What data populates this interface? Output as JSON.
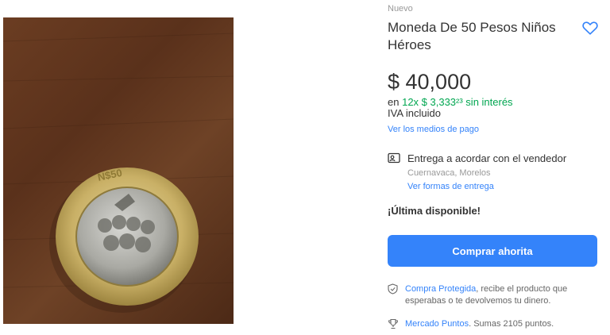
{
  "product": {
    "condition": "Nuevo",
    "title": "Moneda De 50 Pesos Niños Héroes",
    "price": "$ 40,000",
    "installments_prefix": "en",
    "installments_highlight": "12x $ 3,333²³ sin interés",
    "tax_note": "IVA incluido",
    "payment_methods_link": "Ver los medios de pago"
  },
  "delivery": {
    "title": "Entrega a acordar con el vendedor",
    "location": "Cuernavaca, Morelos",
    "link": "Ver formas de entrega"
  },
  "stock": "¡Última disponible!",
  "buy_button": "Comprar ahorita",
  "protection": {
    "link": "Compra Protegida",
    "text": ", recibe el producto que esperabas o te devolvemos tu dinero."
  },
  "points": {
    "link": "Mercado Puntos",
    "text": ". Sumas 2105 puntos."
  },
  "colors": {
    "accent": "#3483fa",
    "green": "#00a650"
  },
  "icons": {
    "favorite": "heart-icon",
    "delivery": "id-card-icon",
    "protection": "shield-icon",
    "points": "trophy-icon"
  }
}
